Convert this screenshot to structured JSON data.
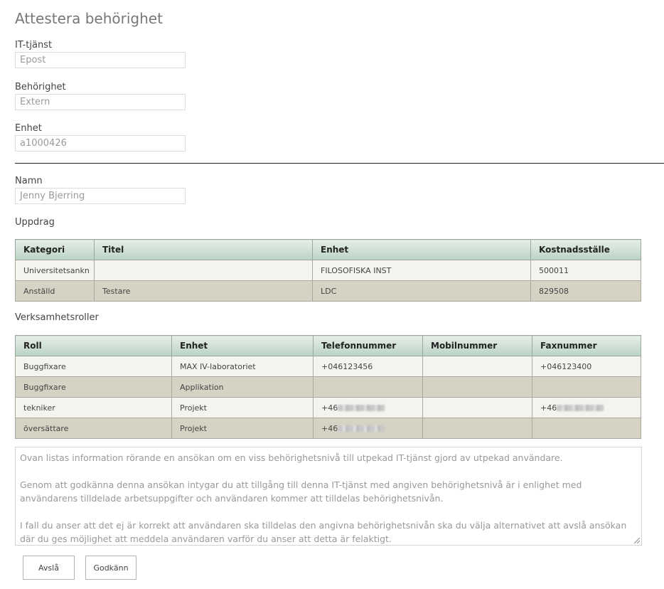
{
  "page": {
    "title": "Attestera behörighet"
  },
  "form": {
    "it_service_label": "IT-tjänst",
    "it_service_value": "Epost",
    "permission_label": "Behörighet",
    "permission_value": "Extern",
    "unit_label": "Enhet",
    "unit_value": "a1000426",
    "name_label": "Namn",
    "name_value": "Jenny Bjerring"
  },
  "assignments": {
    "heading": "Uppdrag",
    "columns": [
      "Kategori",
      "Titel",
      "Enhet",
      "Kostnadsställe"
    ],
    "rows": [
      [
        "Universitetsankn",
        "",
        "FILOSOFISKA INST",
        "500011"
      ],
      [
        "Anställd",
        "Testare",
        "LDC",
        "829508"
      ]
    ]
  },
  "roles": {
    "heading": "Verksamhetsroller",
    "columns": [
      "Roll",
      "Enhet",
      "Telefonnummer",
      "Mobilnummer",
      "Faxnummer"
    ],
    "rows": [
      [
        "Buggfixare",
        "MAX IV-laboratoriet",
        "+046123456",
        "",
        "+046123400"
      ],
      [
        "Buggfixare",
        "Applikation",
        "",
        "",
        ""
      ],
      [
        "tekniker",
        "Projekt",
        "+46",
        "",
        "+46"
      ],
      [
        "översättare",
        "Projekt",
        "+46",
        "",
        ""
      ]
    ]
  },
  "info_text": {
    "p1": "Ovan listas information rörande en ansökan om en viss behörighetsnivå till utpekad IT-tjänst gjord av utpekad användare.",
    "p2": "Genom att godkänna denna ansökan intygar du att tillgång till denna IT-tjänst med angiven behörighetsnivå är i enlighet med användarens tilldelade arbetsuppgifter och användaren kommer att tilldelas behörighetsnivån.",
    "p3": "I fall du anser att det ej är korrekt att användaren ska tilldelas den angivna behörighetsnivån ska du välja alternativet att avslå ansökan där du ges möjlighet att meddela användaren varför du anser att detta är felaktigt."
  },
  "buttons": {
    "reject": "Avslå",
    "approve": "Godkänn"
  }
}
